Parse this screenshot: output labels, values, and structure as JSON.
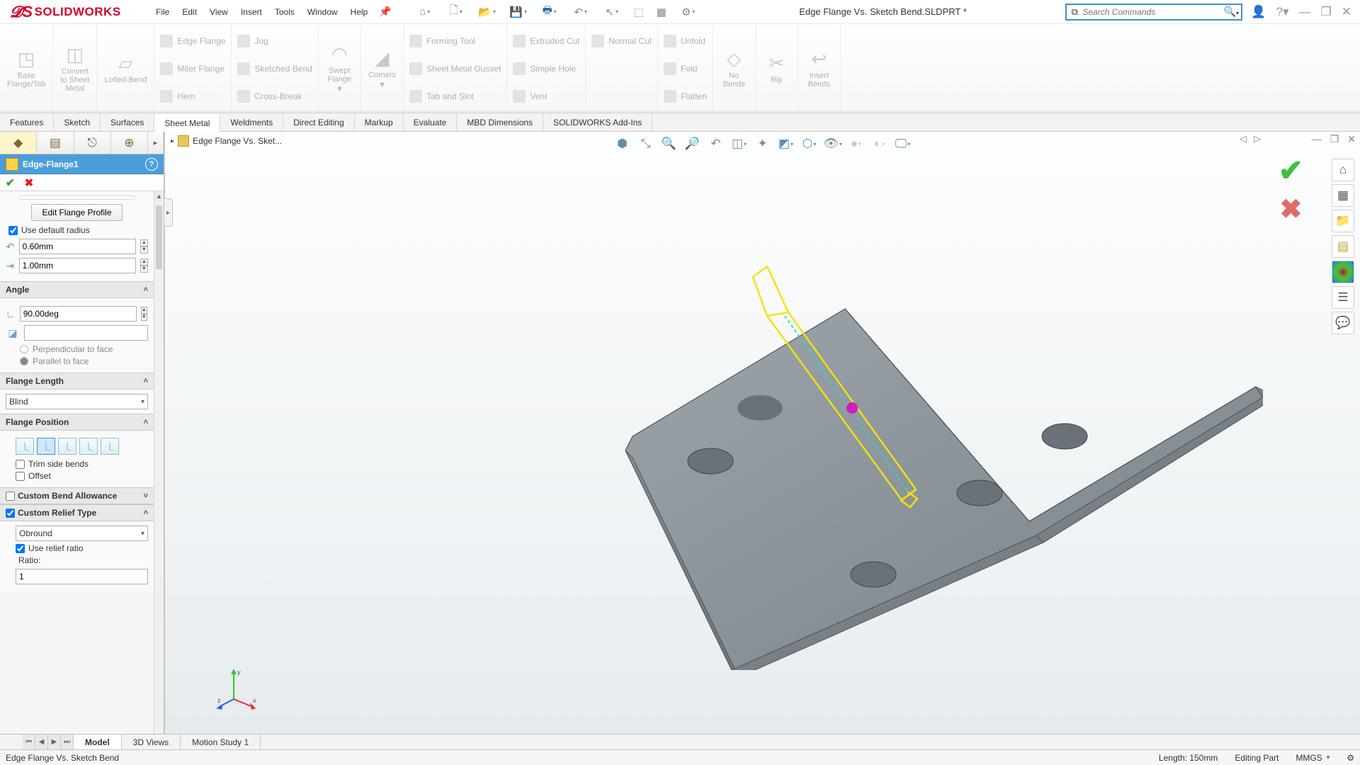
{
  "app": {
    "brand": "SOLIDWORKS",
    "doc_title": "Edge Flange Vs. Sketch Bend.SLDPRT *"
  },
  "menus": [
    "File",
    "Edit",
    "View",
    "Insert",
    "Tools",
    "Window",
    "Help"
  ],
  "search": {
    "placeholder": "Search Commands"
  },
  "ribbon": {
    "big": [
      {
        "label": "Base\nFlange/Tab"
      },
      {
        "label": "Convert\nto Sheet\nMetal"
      },
      {
        "label": "Lofted-Bend"
      }
    ],
    "cols": [
      [
        "Edge Flange",
        "Miter Flange",
        "Hem"
      ],
      [
        "Jog",
        "Sketched Bend",
        "Cross-Break"
      ]
    ],
    "mid": [
      {
        "label": "Swept\nFlange"
      },
      {
        "label": "Corners"
      }
    ],
    "cols2": [
      [
        "Forming Tool",
        "Sheet Metal Gusset",
        "Tab and Slot"
      ],
      [
        "Extruded Cut",
        "Simple Hole",
        "Vent"
      ],
      [
        "Normal Cut"
      ],
      [
        "Unfold",
        "Fold",
        "Flatten"
      ]
    ],
    "right": [
      {
        "label": "No\nBends"
      },
      {
        "label": "Rip"
      },
      {
        "label": "Insert\nBends"
      }
    ]
  },
  "ribbon_tabs": [
    "Features",
    "Sketch",
    "Surfaces",
    "Sheet Metal",
    "Weldments",
    "Direct Editing",
    "Markup",
    "Evaluate",
    "MBD Dimensions",
    "SOLIDWORKS Add-Ins"
  ],
  "breadcrumb": "Edge Flange Vs. Sket...",
  "feature": {
    "title": "Edge-Flange1",
    "edit_btn": "Edit Flange Profile",
    "use_default_radius": "Use default radius",
    "radius_val": "0.60mm",
    "gap_val": "1.00mm",
    "angle_header": "Angle",
    "angle_val": "90.00deg",
    "perp": "Perpendicular to face",
    "parallel": "Parallel to face",
    "flen_header": "Flange Length",
    "flen_mode": "Blind",
    "fpos_header": "Flange Position",
    "trim": "Trim side bends",
    "offset": "Offset",
    "cba": "Custom Bend Allowance",
    "crt": "Custom Relief Type",
    "relief_mode": "Obround",
    "use_ratio": "Use relief ratio",
    "ratio_label": "Ratio:",
    "ratio_val": "1"
  },
  "bottom_tabs": [
    "Model",
    "3D Views",
    "Motion Study 1"
  ],
  "status": {
    "left": "Edge Flange Vs. Sketch Bend",
    "length": "Length: 150mm",
    "mode": "Editing Part",
    "units": "MMGS"
  }
}
